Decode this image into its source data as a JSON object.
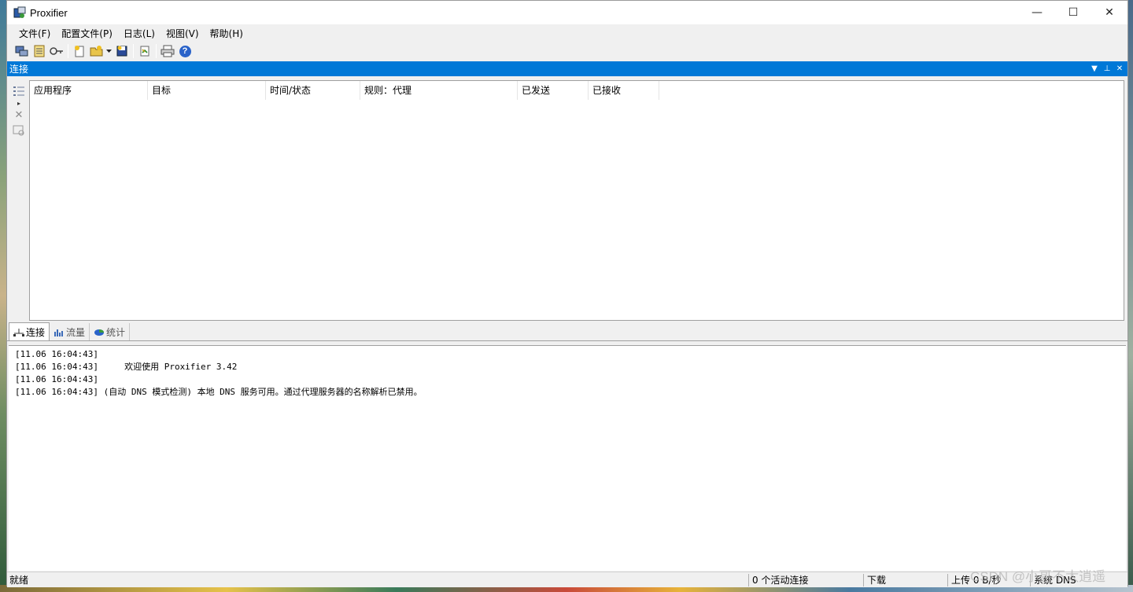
{
  "window": {
    "title": "Proxifier",
    "minimize": "—",
    "maximize": "☐",
    "close": "✕"
  },
  "menu": {
    "items": [
      {
        "label": "文件(F)"
      },
      {
        "label": "配置文件(P)"
      },
      {
        "label": "日志(L)"
      },
      {
        "label": "视图(V)"
      },
      {
        "label": "帮助(H)"
      }
    ]
  },
  "toolbar": {
    "icons": [
      "connections-icon",
      "profile-icon",
      "proxy-servers-icon",
      "new-profile-icon",
      "open-profile-icon",
      "dropdown-arrow-icon",
      "save-profile-icon",
      "refresh-icon",
      "print-icon",
      "help-icon"
    ]
  },
  "connections_panel": {
    "title": "连接",
    "controls": [
      "▼",
      "⊥",
      "✕"
    ],
    "columns": [
      {
        "label": "应用程序"
      },
      {
        "label": "目标"
      },
      {
        "label": "时间/状态"
      },
      {
        "label": "规则：代理"
      },
      {
        "label": "已发送"
      },
      {
        "label": "已接收"
      }
    ],
    "rows": []
  },
  "tabs": [
    {
      "label": "连接",
      "active": true,
      "icon": "network-icon"
    },
    {
      "label": "流量",
      "active": false,
      "icon": "traffic-chart-icon"
    },
    {
      "label": "统计",
      "active": false,
      "icon": "pie-chart-icon"
    }
  ],
  "log": {
    "lines": [
      {
        "text": "[11.06 16:04:43]"
      },
      {
        "text": "[11.06 16:04:43]     欢迎使用 Proxifier 3.42"
      },
      {
        "text": "[11.06 16:04:43]"
      },
      {
        "text": "[11.06 16:04:43] (自动 DNS 模式检测) 本地 DNS 服务可用。通过代理服务器的名称解析已禁用。"
      }
    ]
  },
  "status": {
    "ready": "就绪",
    "active_connections": "0 个活动连接",
    "download": "下载",
    "upload": "上传 0 B/秒",
    "dns": "系统 DNS"
  },
  "watermark": "CSDN @小哥不太逍遥"
}
